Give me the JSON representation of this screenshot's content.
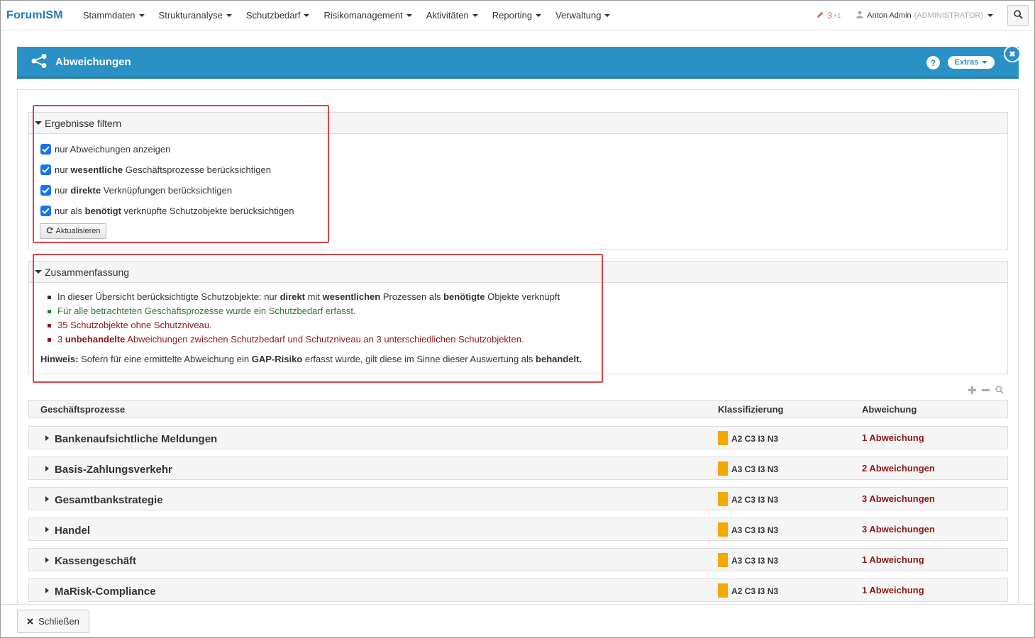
{
  "brand": {
    "forum": "Forum",
    "ism": "ISM"
  },
  "nav": [
    {
      "label": "Stammdaten"
    },
    {
      "label": "Strukturanalyse"
    },
    {
      "label": "Schutzbedarf"
    },
    {
      "label": "Risikomanagement"
    },
    {
      "label": "Aktivitäten"
    },
    {
      "label": "Reporting"
    },
    {
      "label": "Verwaltung"
    }
  ],
  "user": {
    "notif_count": "3",
    "notif_sup": "+1",
    "name": "Anton Admin",
    "role": "(ADMINISTRATOR)"
  },
  "panel": {
    "title": "Abweichungen",
    "help": "?",
    "extras": "Extras"
  },
  "filter": {
    "title": "Ergebnisse filtern",
    "items": [
      {
        "pre": "nur Abweichungen anzeigen",
        "bold": "",
        "post": "",
        "checked": true
      },
      {
        "pre": "nur ",
        "bold": "wesentliche",
        "post": " Geschäftsprozesse berücksichtigen",
        "checked": true
      },
      {
        "pre": "nur ",
        "bold": "direkte",
        "post": " Verknüpfungen berücksichtigen",
        "checked": true
      },
      {
        "pre": "nur als ",
        "bold": "benötigt",
        "post": " verknüpfte Schutzobjekte berücksichtigen",
        "checked": true
      }
    ],
    "refresh": "Aktualisieren"
  },
  "summary": {
    "title": "Zusammenfassung",
    "line1": {
      "a": "In dieser Übersicht berücksichtigte Schutzobjekte: nur ",
      "b": "direkt",
      "c": " mit ",
      "d": "wesentlichen",
      "e": " Prozessen als ",
      "f": "benötigte",
      "g": " Objekte verknüpft"
    },
    "line2": "Für alle betrachteten Geschäftsprozesse wurde ein Schutzbedarf erfasst.",
    "line3": "35 Schutzobjekte ohne Schutzniveau.",
    "line4": {
      "a": "3 ",
      "b": "unbehandelte",
      "c": " Abweichungen zwischen Schutzbedarf und Schutzniveau an 3 unterschiedlichen Schutzobjekten."
    },
    "note": {
      "a": "Hinweis:",
      "b": " Sofern für eine ermittelte Abweichung ein ",
      "c": "GAP-Risiko",
      "d": " erfasst wurde, gilt diese im Sinne dieser Auswertung als ",
      "e": "behandelt."
    }
  },
  "table": {
    "columns": {
      "process": "Geschäftsprozesse",
      "class": "Klassifizierung",
      "deviation": "Abweichung"
    },
    "rows": [
      {
        "name": "Bankenaufsichtliche Meldungen",
        "klass": "A2 C3 I3 N3",
        "dev": "1 Abweichung"
      },
      {
        "name": "Basis-Zahlungsverkehr",
        "klass": "A3 C3 I3 N3",
        "dev": "2 Abweichungen"
      },
      {
        "name": "Gesamtbankstrategie",
        "klass": "A2 C3 I3 N3",
        "dev": "3 Abweichungen"
      },
      {
        "name": "Handel",
        "klass": "A3 C3 I3 N3",
        "dev": "3 Abweichungen"
      },
      {
        "name": "Kassengeschäft",
        "klass": "A3 C3 I3 N3",
        "dev": "1 Abweichung"
      },
      {
        "name": "MaRisk-Compliance",
        "klass": "A2 C3 I3 N3",
        "dev": "1 Abweichung"
      }
    ]
  },
  "footer": {
    "close": "Schließen"
  },
  "colors": {
    "primary": "#2a91c6",
    "swatch": "#f5a800",
    "deviation": "#8b1a1a",
    "ok": "#2d7a2d",
    "highlight": "#e0434a"
  }
}
